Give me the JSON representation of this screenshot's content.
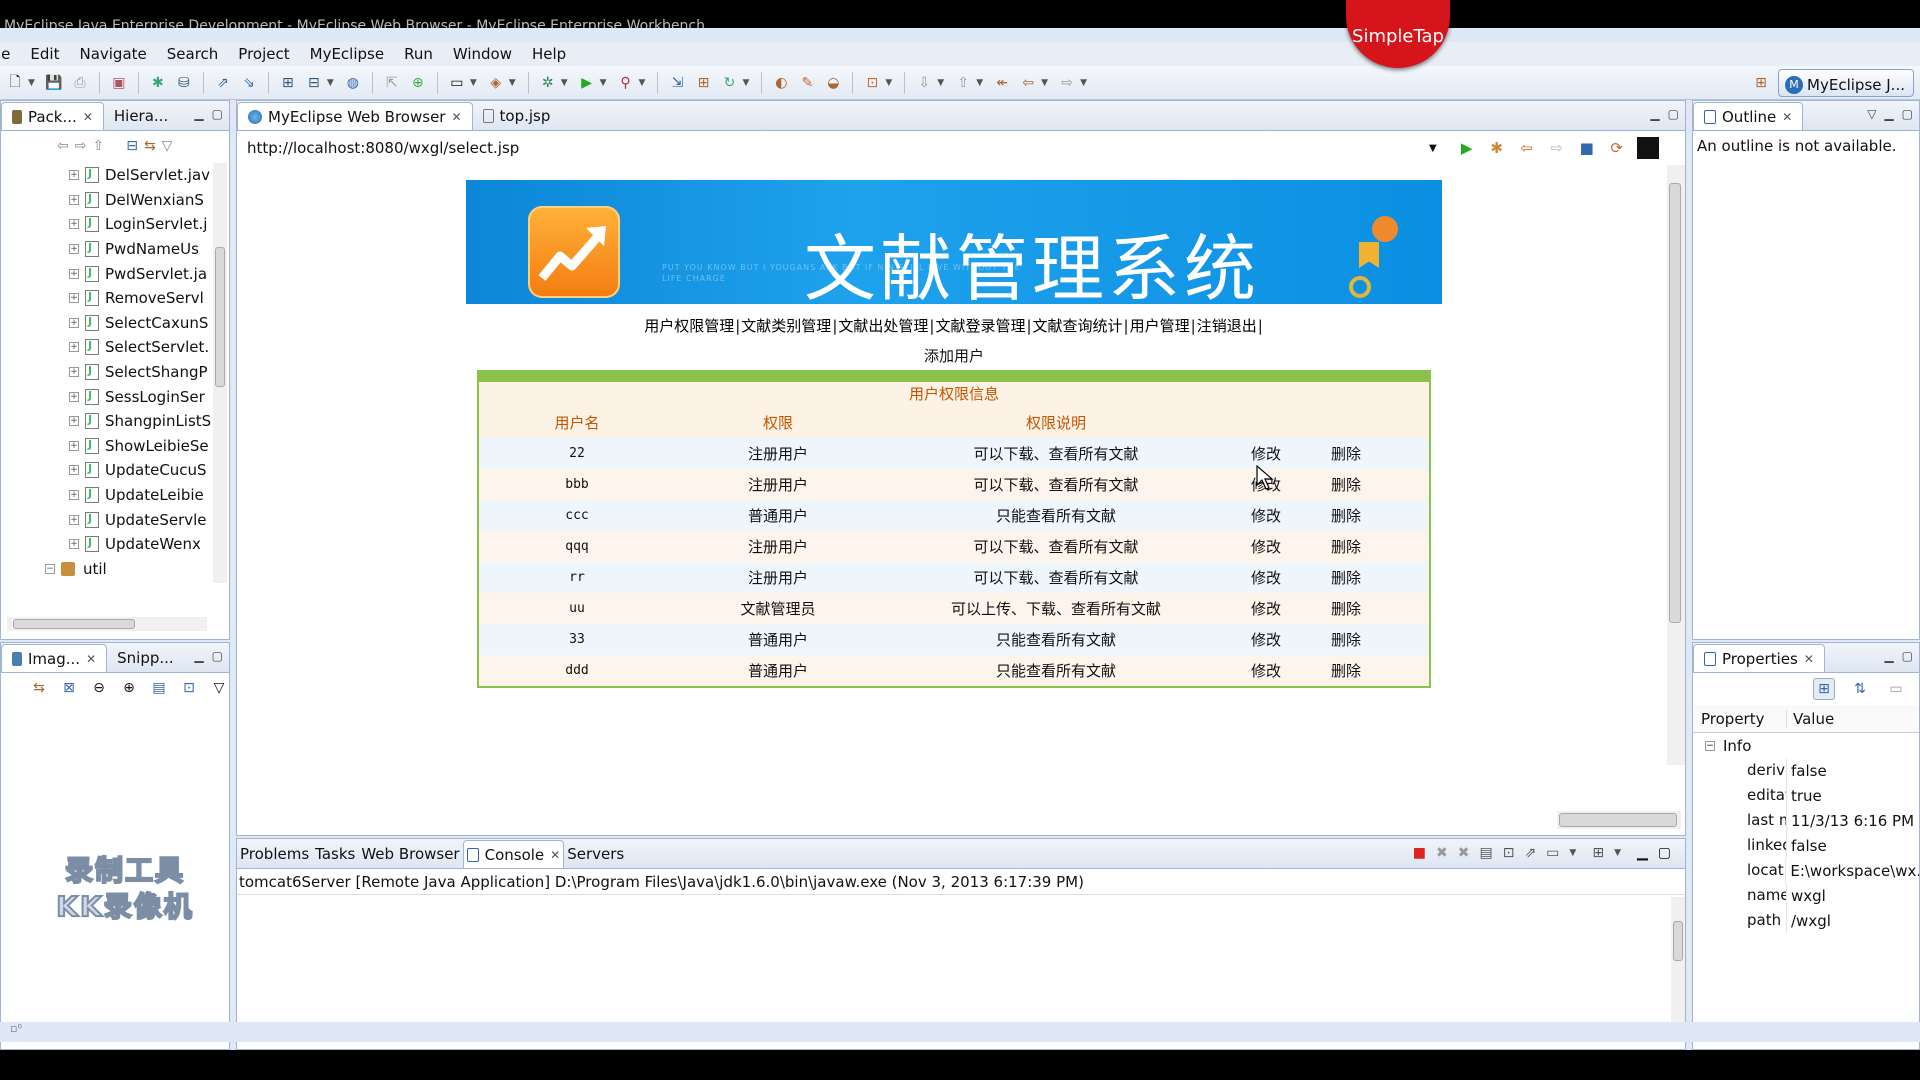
{
  "window": {
    "title": "MyEclipse Java Enterprise Development - MyEclipse Web Browser - MyEclipse Enterprise Workbench",
    "overlay_badge": "SimpleTap"
  },
  "menu": [
    "le",
    "Edit",
    "Navigate",
    "Search",
    "Project",
    "MyEclipse",
    "Run",
    "Window",
    "Help"
  ],
  "perspective": {
    "label": "MyEclipse J..."
  },
  "package_explorer": {
    "tabs": [
      {
        "label": "Pack..."
      },
      {
        "label": "Hiera..."
      }
    ],
    "files": [
      "DelServlet.jav",
      "DelWenxianS",
      "LoginServlet.j",
      "PwdNameUs",
      "PwdServlet.ja",
      "RemoveServl",
      "SelectCaxunS",
      "SelectServlet.",
      "SelectShangP",
      "SessLoginSer",
      "ShangpinListS",
      "ShowLeibieSe",
      "UpdateCucuS",
      "UpdateLeibie",
      "UpdateServle",
      "UpdateWenx"
    ],
    "folder": "util"
  },
  "image_panel": {
    "tabs": [
      {
        "label": "Imag..."
      },
      {
        "label": "Snipp..."
      }
    ],
    "watermark": [
      "录制工具",
      "KK录像机"
    ]
  },
  "editor_tabs": [
    {
      "label": "MyEclipse Web Browser"
    },
    {
      "label": "top.jsp"
    }
  ],
  "browser": {
    "url": "http://localhost:8080/wxgl/select.jsp",
    "banner_title": "文献管理系统",
    "banner_fine_text": "PUT YOU KNOW BUT I YOUGANS   ASK   BUT IF NIN STILL LIVE WITHOUT THE LIFE CHARGE",
    "nav_links": [
      "用户权限管理",
      "文献类别管理",
      "文献出处管理",
      "文献登录管理",
      "文献查询统计",
      "用户管理",
      "注销退出"
    ],
    "nav_separator": "|",
    "add_link": "添加用户",
    "table": {
      "caption": "用户权限信息",
      "headers": [
        "用户名",
        "权限",
        "权限说明",
        "",
        ""
      ],
      "rows": [
        {
          "user": "22",
          "role": "注册用户",
          "desc": "可以下载、查看所有文献",
          "edit": "修改",
          "del": "删除"
        },
        {
          "user": "bbb",
          "role": "注册用户",
          "desc": "可以下载、查看所有文献",
          "edit": "修改",
          "del": "删除"
        },
        {
          "user": "ccc",
          "role": "普通用户",
          "desc": "只能查看所有文献",
          "edit": "修改",
          "del": "删除"
        },
        {
          "user": "qqq",
          "role": "注册用户",
          "desc": "可以下载、查看所有文献",
          "edit": "修改",
          "del": "删除"
        },
        {
          "user": "rr",
          "role": "注册用户",
          "desc": "可以下载、查看所有文献",
          "edit": "修改",
          "del": "删除"
        },
        {
          "user": "uu",
          "role": "文献管理员",
          "desc": "可以上传、下载、查看所有文献",
          "edit": "修改",
          "del": "删除"
        },
        {
          "user": "33",
          "role": "普通用户",
          "desc": "只能查看所有文献",
          "edit": "修改",
          "del": "删除"
        },
        {
          "user": "ddd",
          "role": "普通用户",
          "desc": "只能查看所有文献",
          "edit": "修改",
          "del": "删除"
        }
      ]
    }
  },
  "console": {
    "tabs": [
      {
        "label": "Problems"
      },
      {
        "label": "Tasks"
      },
      {
        "label": "Web Browser"
      },
      {
        "label": "Console"
      },
      {
        "label": "Servers"
      }
    ],
    "title": "tomcat6Server [Remote Java Application] D:\\Program Files\\Java\\jdk1.6.0\\bin\\javaw.exe (Nov 3, 2013 6:17:39 PM)"
  },
  "outline": {
    "tab": "Outline",
    "message": "An outline is not available."
  },
  "properties": {
    "tab": "Properties",
    "headers": [
      "Property",
      "Value"
    ],
    "group": "Info",
    "rows": [
      {
        "key": "derive",
        "value": "false"
      },
      {
        "key": "editat",
        "value": "true"
      },
      {
        "key": "last m",
        "value": "11/3/13 6:16 PM"
      },
      {
        "key": "linked",
        "value": "false"
      },
      {
        "key": "locati",
        "value": "E:\\workspace\\wx."
      },
      {
        "key": "name",
        "value": "wxgl"
      },
      {
        "key": "path",
        "value": "/wxgl"
      }
    ]
  },
  "colors": {
    "banner_blue": "#1fa2ec",
    "table_border_green": "#8bc34a",
    "header_orange": "#c45500",
    "badge_red": "#d6141b"
  }
}
